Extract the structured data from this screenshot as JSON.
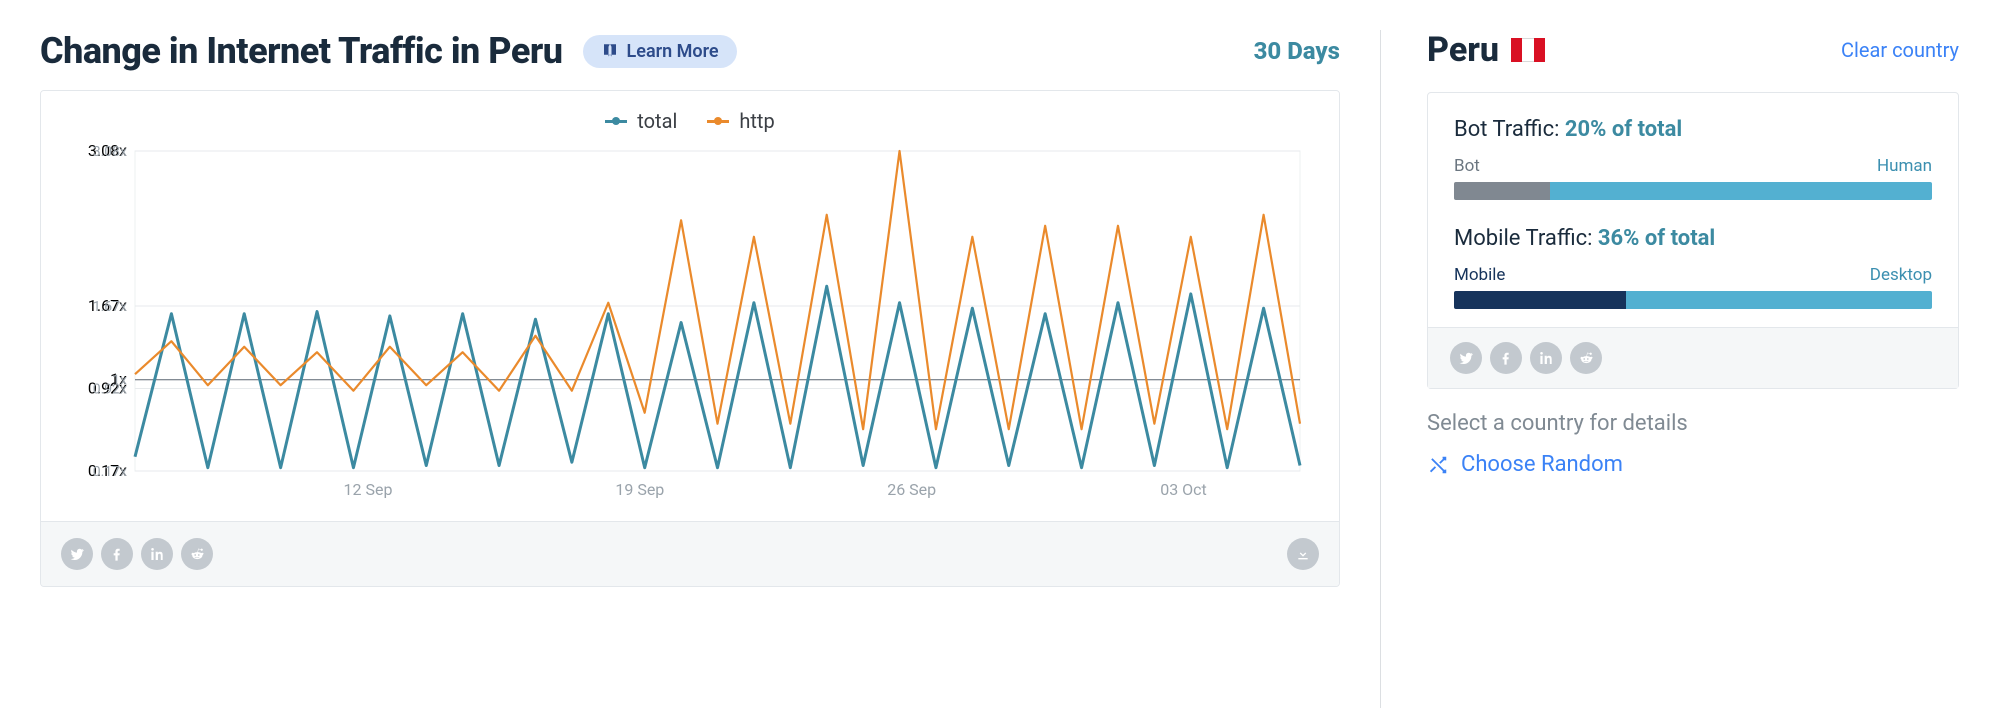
{
  "header": {
    "title": "Change in Internet Traffic in Peru",
    "learn_more": "Learn More",
    "period": "30 Days"
  },
  "legend": {
    "total": "total",
    "http": "http"
  },
  "colors": {
    "total": "#3c8aa1",
    "http": "#ea8a2c",
    "bot": "#808891",
    "human": "#53b0d1",
    "mobile": "#16335b",
    "desktop": "#53b0d1"
  },
  "sidebar": {
    "country": "Peru",
    "clear": "Clear country",
    "hint": "Select a country for details",
    "random": "Choose Random",
    "bot": {
      "title_prefix": "Bot Traffic: ",
      "value": "20% of total",
      "left_label": "Bot",
      "right_label": "Human",
      "left_pct": 20
    },
    "mobile": {
      "title_prefix": "Mobile Traffic: ",
      "value": "36% of total",
      "left_label": "Mobile",
      "right_label": "Desktop",
      "left_pct": 36
    }
  },
  "chart_data": {
    "type": "line",
    "title": "Change in Internet Traffic in Peru",
    "xlabel": "",
    "ylabel": "",
    "ylim": [
      0.17,
      3.08
    ],
    "y_ticks": [
      0.17,
      0.92,
      1.0,
      1.67,
      3.08
    ],
    "y_tick_labels": [
      "0.17x",
      "0.92x",
      "1x",
      "1.67x",
      "3.08x"
    ],
    "x_tick_labels": [
      "12 Sep",
      "19 Sep",
      "26 Sep",
      "03 Oct"
    ],
    "x_tick_positions": [
      6,
      13,
      20,
      27
    ],
    "x_range": [
      0,
      30
    ],
    "series": [
      {
        "name": "total",
        "values": [
          0.3,
          1.6,
          0.2,
          1.6,
          0.2,
          1.62,
          0.2,
          1.58,
          0.22,
          1.6,
          0.22,
          1.55,
          0.25,
          1.6,
          0.2,
          1.52,
          0.2,
          1.7,
          0.2,
          1.85,
          0.22,
          1.7,
          0.2,
          1.65,
          0.22,
          1.6,
          0.2,
          1.7,
          0.22,
          1.78,
          0.2,
          1.65,
          0.22
        ]
      },
      {
        "name": "http",
        "values": [
          1.05,
          1.35,
          0.95,
          1.3,
          0.95,
          1.25,
          0.9,
          1.3,
          0.95,
          1.25,
          0.9,
          1.4,
          0.9,
          1.7,
          0.7,
          2.45,
          0.6,
          2.3,
          0.6,
          2.5,
          0.55,
          3.08,
          0.55,
          2.3,
          0.55,
          2.4,
          0.55,
          2.4,
          0.6,
          2.3,
          0.55,
          2.5,
          0.6
        ]
      }
    ]
  }
}
